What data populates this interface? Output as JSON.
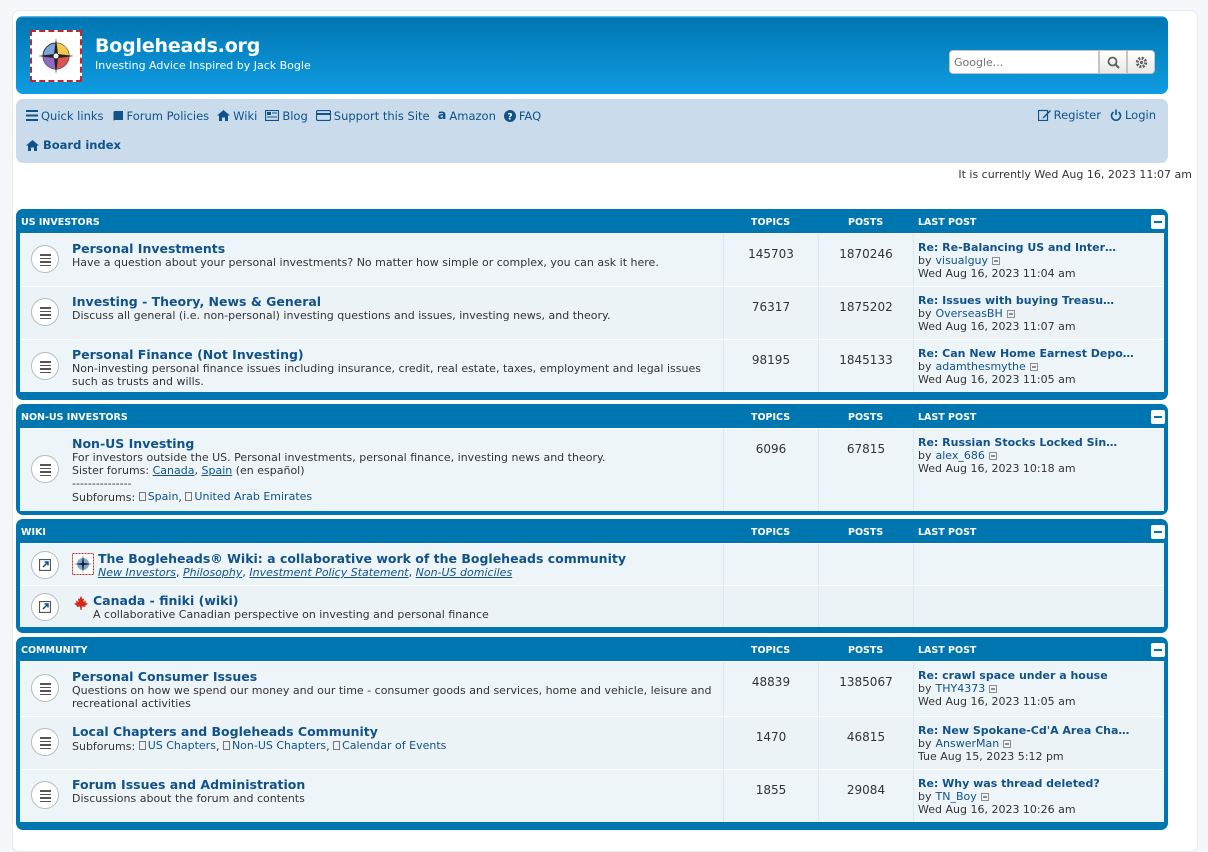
{
  "site": {
    "title": "Bogleheads.org",
    "description": "Investing Advice Inspired by Jack Bogle",
    "search_placeholder": "Google..."
  },
  "nav": {
    "quick_links": "Quick links",
    "forum_policies": "Forum Policies",
    "wiki": "Wiki",
    "blog": "Blog",
    "support": "Support this Site",
    "amazon": "Amazon",
    "faq": "FAQ",
    "register": "Register",
    "login": "Login",
    "board_index": "Board index"
  },
  "time_note": "It is currently Wed Aug 16, 2023 11:07 am",
  "headers": {
    "topics": "TOPICS",
    "posts": "POSTS",
    "last_post": "LAST POST"
  },
  "categories": [
    {
      "name": "US INVESTORS",
      "forums": [
        {
          "title": "Personal Investments",
          "desc": "Have a question about your personal investments? No matter how simple or complex, you can ask it here.",
          "topics": "145703",
          "posts": "1870246",
          "last_title": "Re: Re-Balancing US and Inter…",
          "last_by_label": "by",
          "last_user": "visualguy",
          "last_time": "Wed Aug 16, 2023 11:04 am"
        },
        {
          "title": "Investing - Theory, News & General",
          "desc": "Discuss all general (i.e. non-personal) investing questions and issues, investing news, and theory.",
          "topics": "76317",
          "posts": "1875202",
          "last_title": "Re: Issues with buying Treasu…",
          "last_by_label": "by",
          "last_user": "OverseasBH",
          "last_time": "Wed Aug 16, 2023 11:07 am"
        },
        {
          "title": "Personal Finance (Not Investing)",
          "desc": "Non-investing personal finance issues including insurance, credit, real estate, taxes, employment and legal issues such as trusts and wills.",
          "topics": "98195",
          "posts": "1845133",
          "last_title": "Re: Can New Home Earnest Depo…",
          "last_by_label": "by",
          "last_user": "adamthesmythe",
          "last_time": "Wed Aug 16, 2023 11:05 am"
        }
      ]
    },
    {
      "name": "NON-US INVESTORS",
      "forums": [
        {
          "title": "Non-US Investing",
          "desc": "For investors outside the US. Personal investments, personal finance, investing news and theory.",
          "sister_label": "Sister forums:",
          "sister_1": "Canada",
          "sister_sep": ",",
          "sister_2": "Spain",
          "sister_tail": "(en español)",
          "dashes": "---------------",
          "subforums_label": "Subforums:",
          "sub_1": "Spain",
          "sub_2": "United Arab Emirates",
          "topics": "6096",
          "posts": "67815",
          "last_title": "Re: Russian Stocks Locked Sin…",
          "last_by_label": "by",
          "last_user": "alex_686",
          "last_time": "Wed Aug 16, 2023 10:18 am"
        }
      ]
    },
    {
      "name": "WIKI",
      "forums": [
        {
          "title": "The Bogleheads® Wiki: a collaborative work of the Bogleheads community",
          "links": [
            "New Investors",
            "Philosophy",
            "Investment Policy Statement",
            "Non-US domiciles"
          ]
        },
        {
          "title": "Canada - finiki (wiki)",
          "desc": "A collaborative Canadian perspective on investing and personal finance"
        }
      ]
    },
    {
      "name": "COMMUNITY",
      "forums": [
        {
          "title": "Personal Consumer Issues",
          "desc": "Questions on how we spend our money and our time - consumer goods and services, home and vehicle, leisure and recreational activities",
          "topics": "48839",
          "posts": "1385067",
          "last_title": "Re: crawl space under a house",
          "last_by_label": "by",
          "last_user": "THY4373",
          "last_time": "Wed Aug 16, 2023 11:05 am"
        },
        {
          "title": "Local Chapters and Bogleheads Community",
          "subforums_label": "Subforums:",
          "sub_1": "US Chapters",
          "sub_2": "Non-US Chapters",
          "sub_3": "Calendar of Events",
          "topics": "1470",
          "posts": "46815",
          "last_title": "Re: New Spokane-Cd'A Area Cha…",
          "last_by_label": "by",
          "last_user": "AnswerMan",
          "last_time": "Tue Aug 15, 2023 5:12 pm"
        },
        {
          "title": "Forum Issues and Administration",
          "desc": "Discussions about the forum and contents",
          "topics": "1855",
          "posts": "29084",
          "last_title": "Re: Why was thread deleted?",
          "last_by_label": "by",
          "last_user": "TN_Boy",
          "last_time": "Wed Aug 16, 2023 10:26 am"
        }
      ]
    }
  ]
}
